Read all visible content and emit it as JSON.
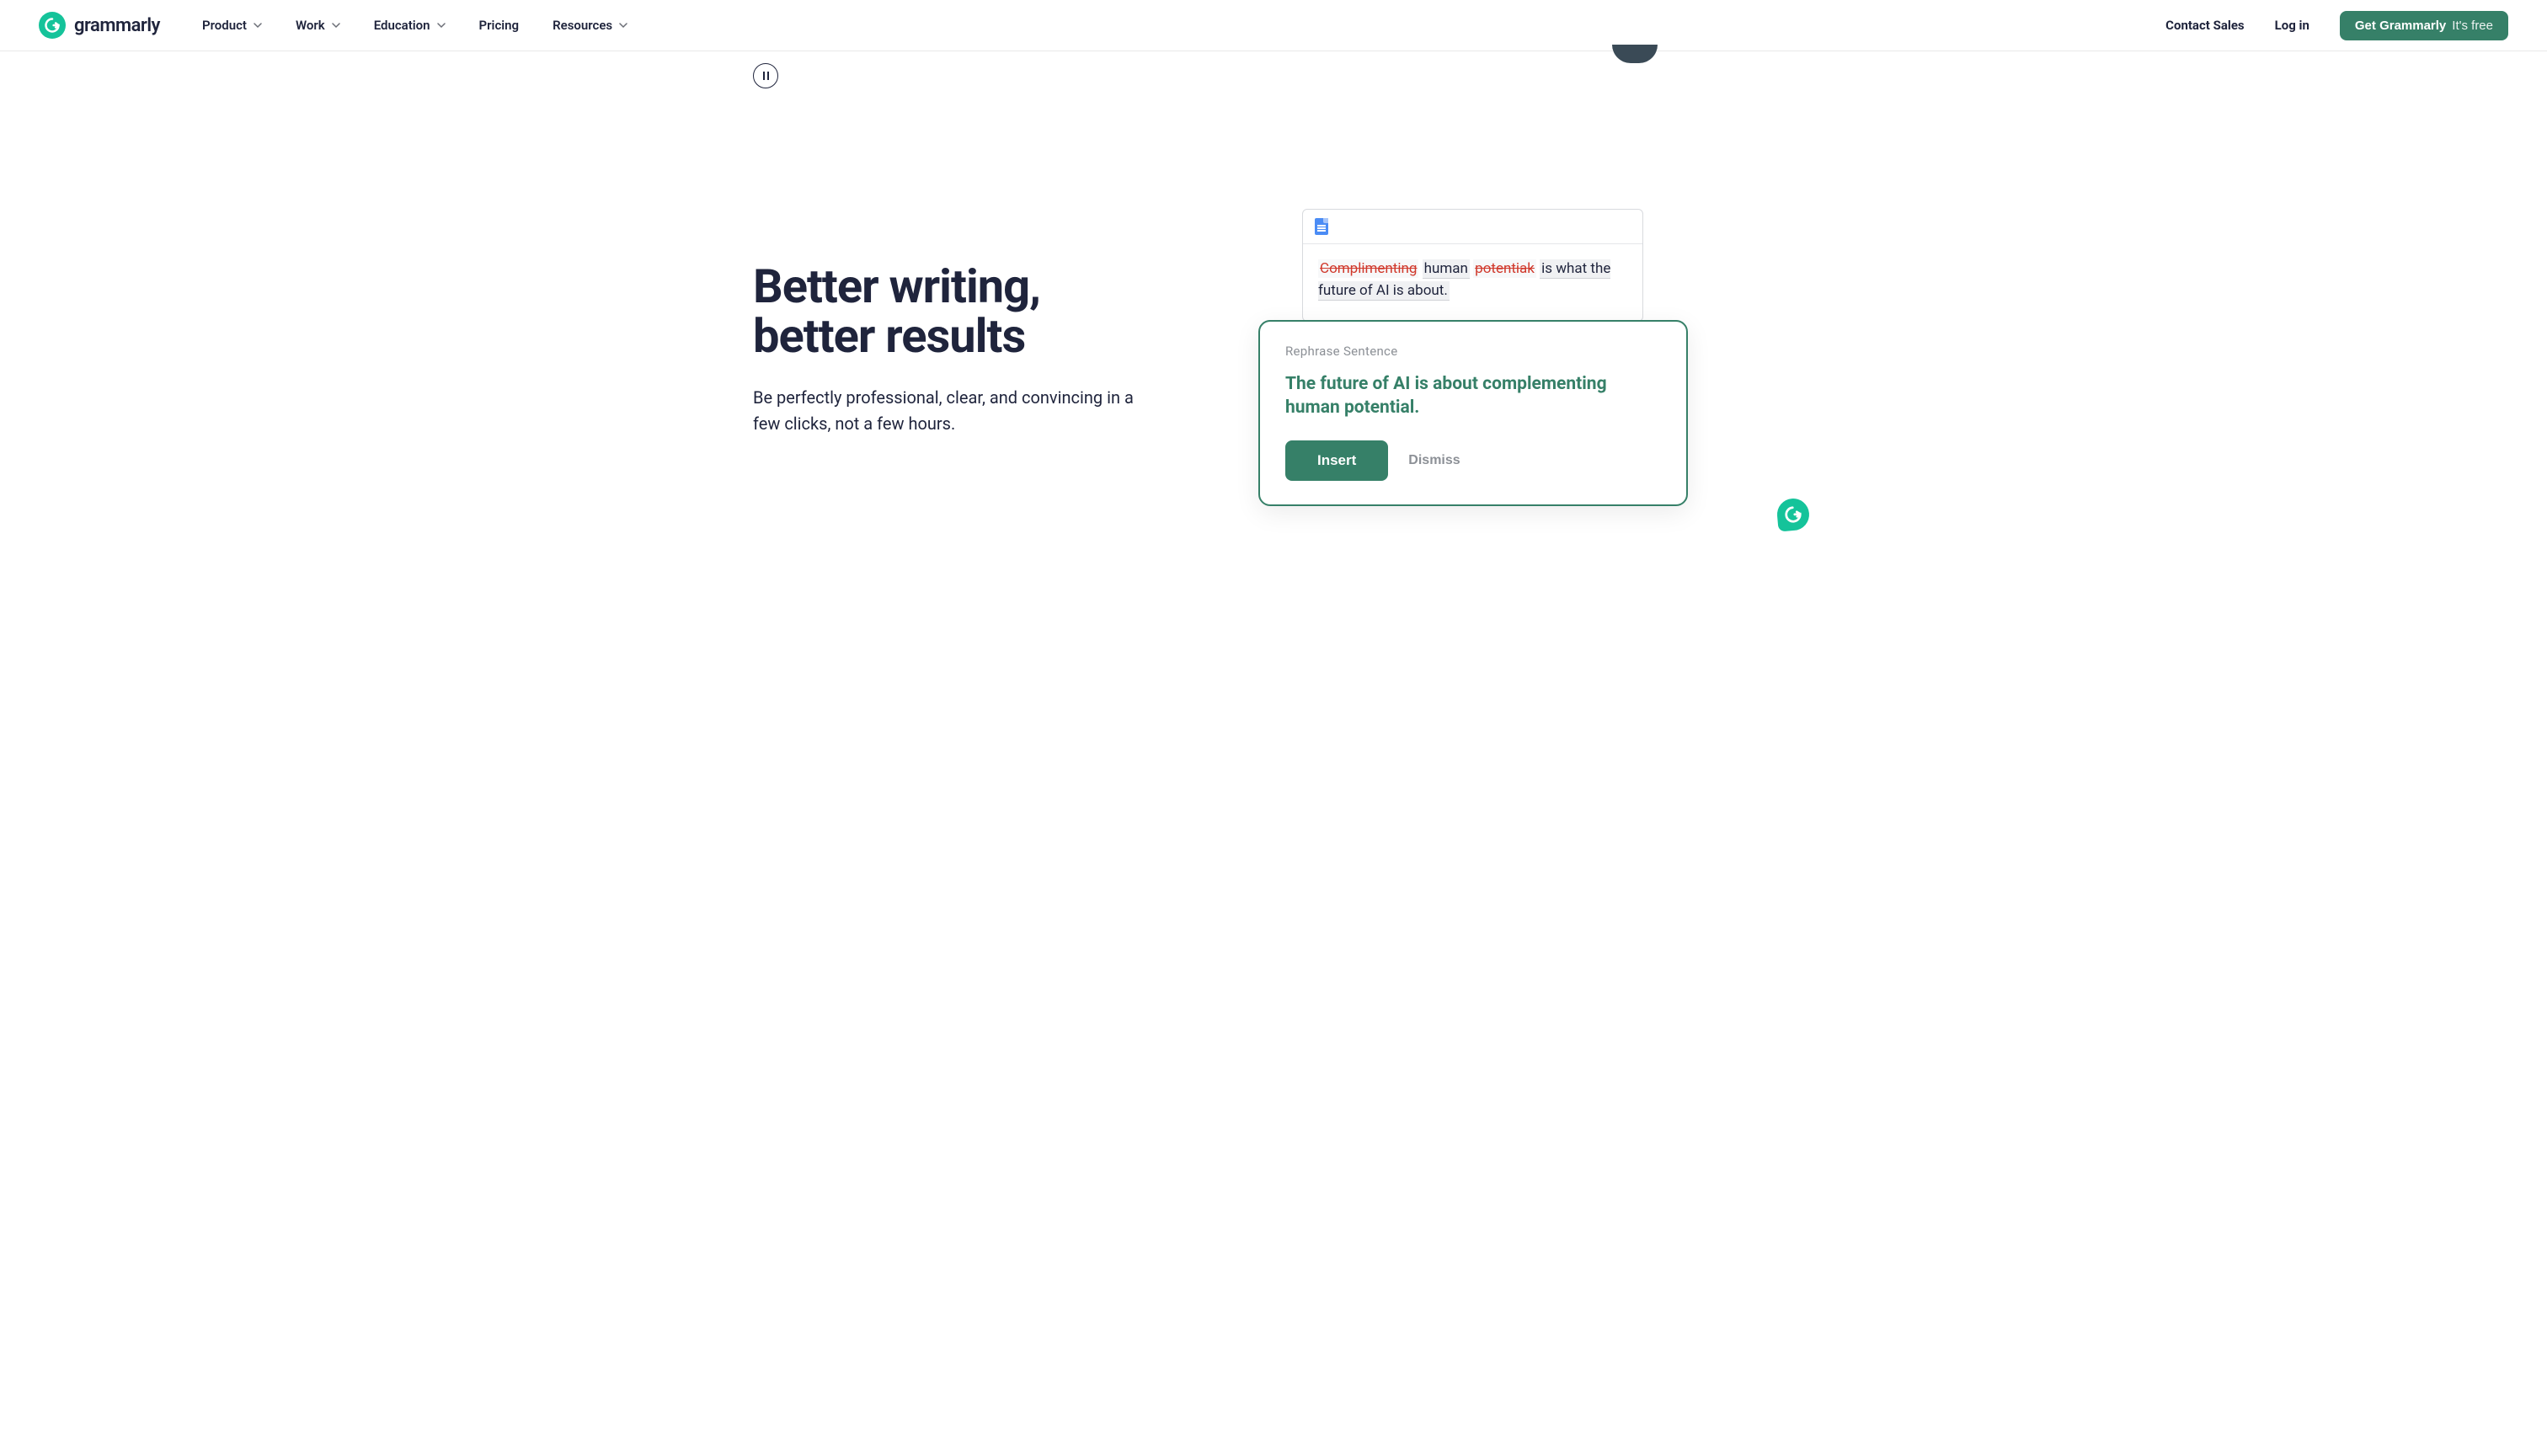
{
  "brand": {
    "name": "grammarly"
  },
  "nav": {
    "items": [
      {
        "label": "Product",
        "hasDropdown": true
      },
      {
        "label": "Work",
        "hasDropdown": true
      },
      {
        "label": "Education",
        "hasDropdown": true
      },
      {
        "label": "Pricing",
        "hasDropdown": false
      },
      {
        "label": "Resources",
        "hasDropdown": true
      }
    ]
  },
  "header": {
    "contactSales": "Contact Sales",
    "login": "Log in",
    "cta": "Get Grammarly",
    "ctaSub": "It's free"
  },
  "hero": {
    "title_line1": "Better writing,",
    "title_line2": "better results",
    "subtitle": "Be perfectly professional, clear, and convincing in a few clicks, not a few hours."
  },
  "demo": {
    "original": {
      "strike1": "Complimenting",
      "mid1": "human",
      "strike2": "potentiak",
      "rest": "is what the future of AI is about."
    },
    "suggestion": {
      "label": "Rephrase Sentence",
      "text": "The future of AI is about complementing human potential.",
      "insert": "Insert",
      "dismiss": "Dismiss"
    }
  },
  "colors": {
    "brand": "#15c39a",
    "accent": "#368068",
    "text": "#1f243c",
    "error": "#d0382b"
  }
}
